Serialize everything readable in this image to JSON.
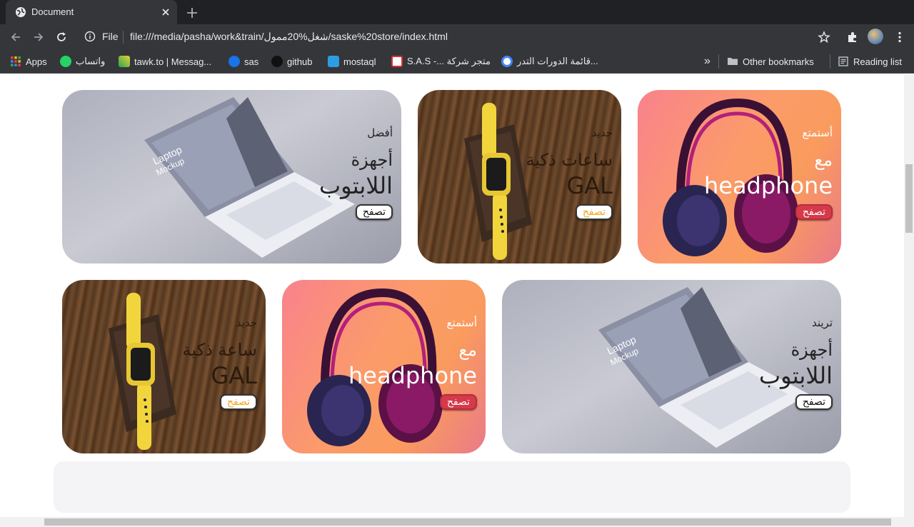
{
  "browser": {
    "tab_title": "Document",
    "file_label": "File",
    "url": "file:///media/pasha/work&train/شغل%20ممول/saske%20store/index.html"
  },
  "bookmarks": {
    "apps": "Apps",
    "items": [
      "واتساب",
      "tawk.to | Messag...",
      "sas",
      "github",
      "mostaql",
      "S.A.S -... متجر شركة",
      "قائمة الدورات التدر..."
    ],
    "other": "Other bookmarks",
    "reading": "Reading list"
  },
  "cards": [
    {
      "small": "أفضل",
      "line2": "أجهزة",
      "line3": "اللابتوب",
      "button": "تصفح",
      "theme": "laptop"
    },
    {
      "small": "جديد",
      "line2": "ساعات ذكية",
      "line3": "GAL",
      "button": "تصفح",
      "theme": "wood"
    },
    {
      "small": "أستمتع",
      "line2": "مع",
      "line3": "headphone",
      "button": "تصفح",
      "theme": "orange"
    },
    {
      "small": "جديد",
      "line2": "ساعة ذكية",
      "line3": "GAL",
      "button": "تصفح",
      "theme": "wood"
    },
    {
      "small": "أستمتع",
      "line2": "مع",
      "line3": "headphone",
      "button": "تصفح",
      "theme": "orange"
    },
    {
      "small": "تريند",
      "line2": "أجهزة",
      "line3": "اللابتوب",
      "button": "تصفح",
      "theme": "laptop"
    }
  ],
  "colors": {
    "chrome_dark": "#202124",
    "chrome_toolbar": "#35363a",
    "browse_wood_text": "#f5a623",
    "browse_orange_bg": "#d63a4a"
  },
  "icons": {
    "back": "arrow-left-icon",
    "forward": "arrow-right-icon",
    "reload": "reload-icon",
    "star": "star-icon",
    "extensions": "puzzle-icon",
    "profile": "avatar",
    "menu": "kebab-icon"
  }
}
